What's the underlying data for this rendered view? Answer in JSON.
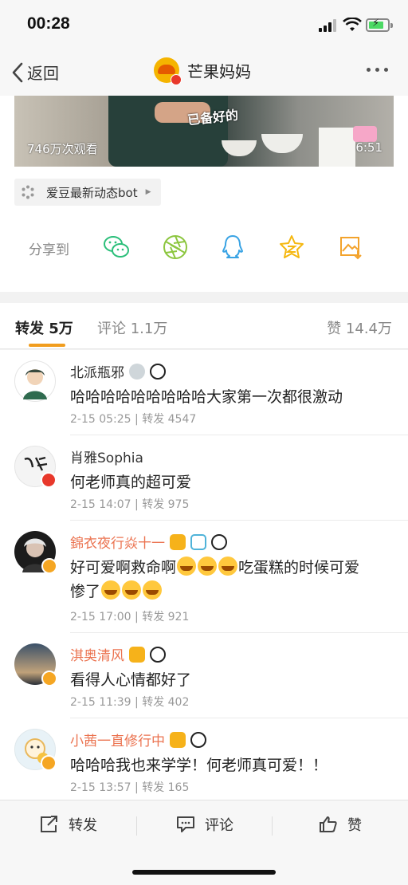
{
  "status_bar": {
    "time": "00:28"
  },
  "nav": {
    "back_label": "返回",
    "title": "芒果妈妈"
  },
  "video": {
    "subtitle": "已备好的",
    "views": "746万次观看",
    "duration": "6:51"
  },
  "source": {
    "label": "爱豆最新动态bot"
  },
  "share": {
    "label": "分享到",
    "targets": [
      "wechat-icon",
      "moments-icon",
      "qq-icon",
      "qzone-icon",
      "save-image-icon"
    ]
  },
  "tabs": {
    "repost": "转发 5万",
    "comment": "评论 1.1万",
    "like": "赞 14.4万"
  },
  "reposts": [
    {
      "name": "北派瓶邪",
      "text": "哈哈哈哈哈哈哈哈哈大家第一次都很激动",
      "date": "2-15 05:25",
      "count": "转发 4547"
    },
    {
      "name": "肖雅Sophia",
      "text": "何老师真的超可爱",
      "date": "2-15 14:07",
      "count": "转发 975"
    },
    {
      "name": "錦衣夜行焱十一",
      "text_a": "好可爱啊救命啊",
      "text_b": "吃蛋糕的时候可爱",
      "text_c": "惨了",
      "date": "2-15 17:00",
      "count": "转发 921"
    },
    {
      "name": "淇奥清风",
      "text": "看得人心情都好了",
      "date": "2-15 11:39",
      "count": "转发 402"
    },
    {
      "name": "小茜一直修行中",
      "text": "哈哈哈我也来学学！何老师真可爱！！",
      "date": "2-15 13:57",
      "count": "转发 165"
    }
  ],
  "bottom": {
    "repost": "转发",
    "comment": "评论",
    "like": "赞"
  },
  "colors": {
    "vip_name": "#eb7350",
    "tab_indicator": "#f19d1e",
    "share_green": "#2bbf7a"
  }
}
